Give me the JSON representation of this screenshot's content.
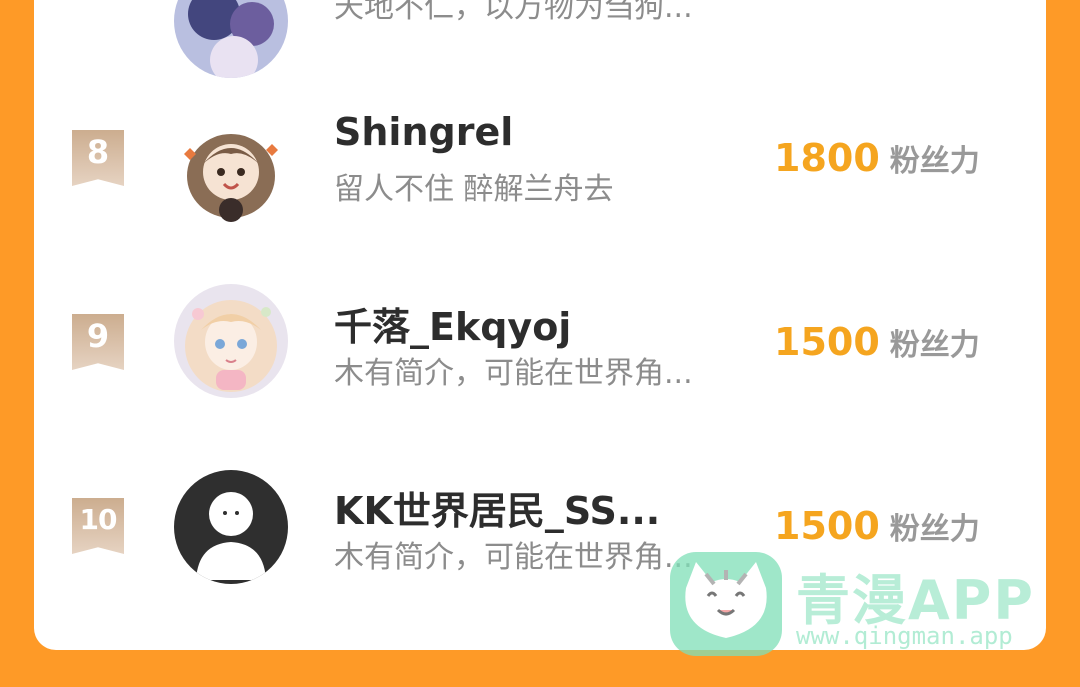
{
  "ranking": {
    "partial_top": {
      "bio": "天地不仁，以万物为刍狗..."
    },
    "items": [
      {
        "rank": "8",
        "name": "Shingrel",
        "bio": "留人不住 醉解兰舟去",
        "fans": "1800",
        "unit": "粉丝力"
      },
      {
        "rank": "9",
        "name": "千落_Ekqyoj",
        "bio": "木有简介，可能在世界角...",
        "fans": "1500",
        "unit": "粉丝力"
      },
      {
        "rank": "10",
        "name": "KK世界居民_SS...",
        "bio": "木有简介，可能在世界角...",
        "fans": "1500",
        "unit": "粉丝力"
      }
    ]
  },
  "watermark": {
    "title": "青漫APP",
    "url": "www.qingman.app"
  },
  "colors": {
    "background": "#fe9a27",
    "fans_number": "#f5a51f",
    "badge": "#d8bfa8",
    "watermark": "#7fe0b8"
  }
}
